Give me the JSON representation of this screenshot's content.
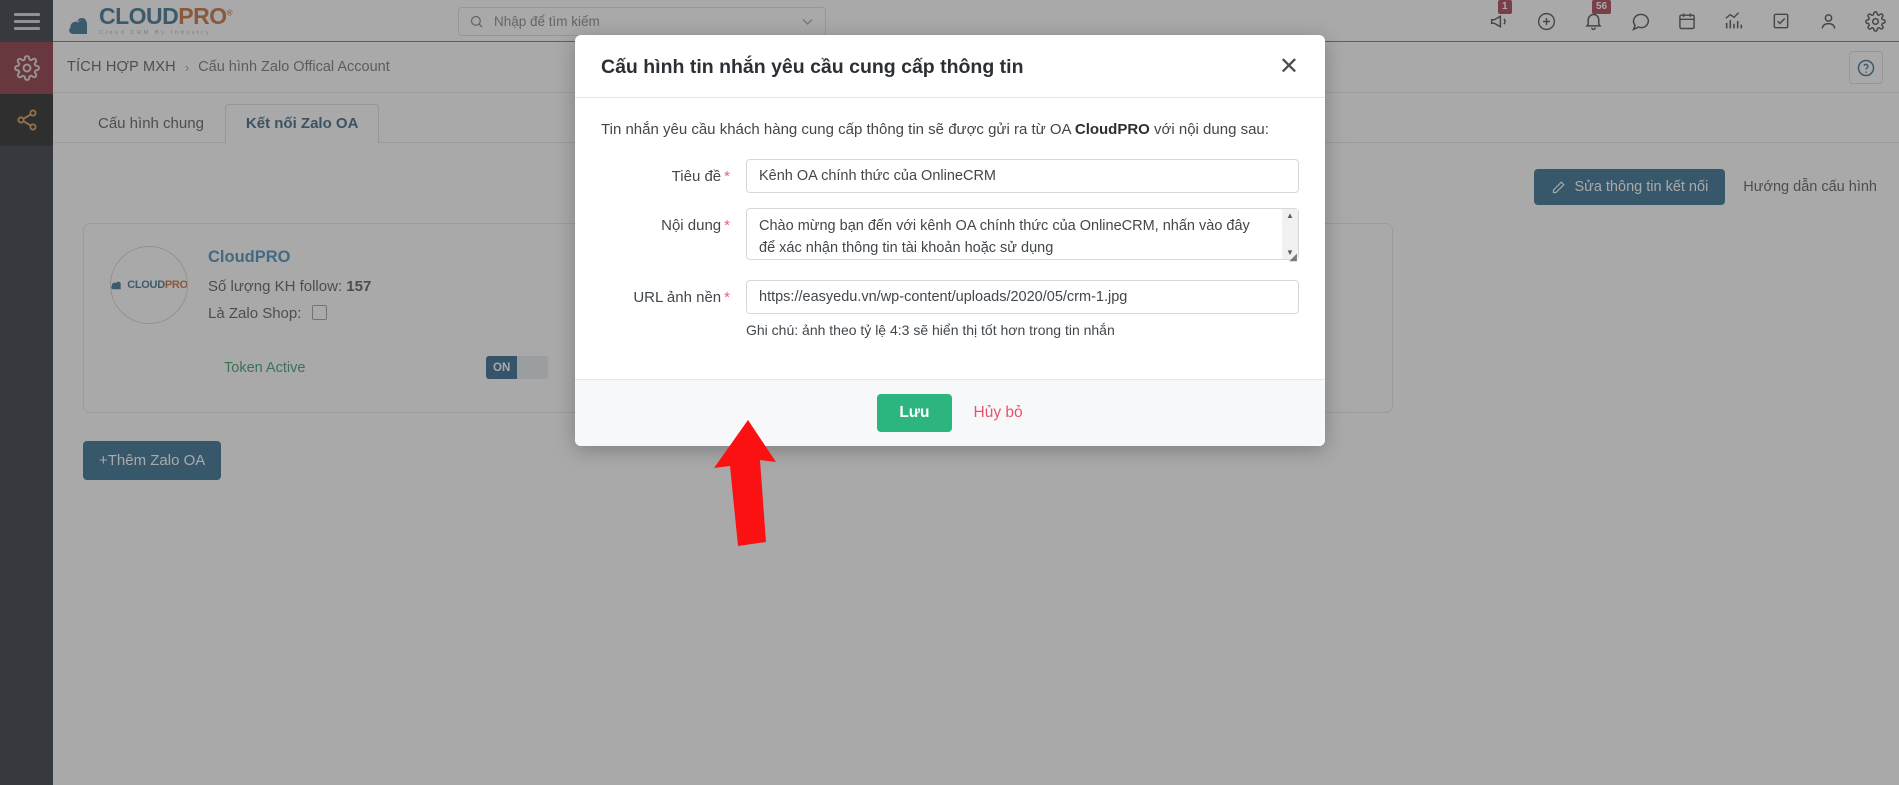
{
  "app": {
    "brand_name_part1": "CLOUD",
    "brand_name_part2": "PRO",
    "brand_tagline": "Cloud CRM By Industry",
    "brand_reg": "®"
  },
  "colors": {
    "primary_blue": "#12557d",
    "accent_orange": "#c05621",
    "save_green": "#2cb57f",
    "cancel_red": "#e8546d",
    "badge_red": "#9b2235",
    "rail_active": "#7a1320",
    "token_green": "#1f8a52"
  },
  "search": {
    "placeholder": "Nhập để tìm kiếm",
    "value": "",
    "icon": "search-icon",
    "chevron": "chevron-down-icon"
  },
  "header_icons": [
    {
      "name": "megaphone-icon",
      "badge": "1"
    },
    {
      "name": "plus-circle-icon",
      "badge": ""
    },
    {
      "name": "bell-icon",
      "badge": "56"
    },
    {
      "name": "chat-icon",
      "badge": ""
    },
    {
      "name": "calendar-icon",
      "badge": ""
    },
    {
      "name": "chart-icon",
      "badge": ""
    },
    {
      "name": "checkbox-icon",
      "badge": ""
    },
    {
      "name": "user-icon",
      "badge": ""
    },
    {
      "name": "gear-icon",
      "badge": ""
    }
  ],
  "rail": {
    "hamburger": "hamburger-icon",
    "items": [
      {
        "name": "gear-icon",
        "active": true
      },
      {
        "name": "share-nodes-icon",
        "active": false
      }
    ]
  },
  "breadcrumb": {
    "parent": "TÍCH HỢP MXH",
    "separator": "›",
    "current": "Cấu hình Zalo Offical Account",
    "help_icon": "question-circle-icon"
  },
  "tabs": [
    {
      "label": "Cấu hình chung",
      "active": false
    },
    {
      "label": "Kết nối Zalo OA",
      "active": true
    }
  ],
  "actions": {
    "edit_connection": "Sửa thông tin kết nối",
    "edit_icon": "pencil-icon",
    "config_guide": "Hướng dẫn cấu hình",
    "add_zalo_oa": "+Thêm Zalo OA"
  },
  "oa_card": {
    "avatar_label": "CLOUDPRO",
    "name": "CloudPRO",
    "follow_label": "Số lượng KH follow:",
    "follow_count": "157",
    "zalo_shop_label": "Là Zalo Shop:",
    "zalo_shop_checked": false,
    "token_label": "Token Active",
    "toggle_state": "ON"
  },
  "modal": {
    "title": "Cấu hình tin nhắn yêu cầu cung cấp thông tin",
    "close_icon": "close-icon",
    "intro_prefix": "Tin nhắn yêu cầu khách hàng cung cấp thông tin sẽ được gửi ra từ OA ",
    "intro_brand": "CloudPRO",
    "intro_suffix": " với nội dung sau:",
    "fields": {
      "title": {
        "label": "Tiêu đề",
        "required": "*",
        "value": "Kênh OA chính thức của OnlineCRM"
      },
      "content": {
        "label": "Nội dung",
        "required": "*",
        "value": "Chào mừng bạn đến với kênh OA chính thức của OnlineCRM, nhấn vào đây để xác nhận thông tin tài khoản hoặc sử dụng",
        "scroll_up": "▲",
        "scroll_down": "▼"
      },
      "image_url": {
        "label": "URL ảnh nền",
        "required": "*",
        "value": "https://easyedu.vn/wp-content/uploads/2020/05/crm-1.jpg",
        "note": "Ghi chú: ảnh theo tỷ lệ 4:3 sẽ hiển thị tốt hơn trong tin nhắn"
      }
    },
    "save_label": "Lưu",
    "cancel_label": "Hủy bỏ"
  }
}
